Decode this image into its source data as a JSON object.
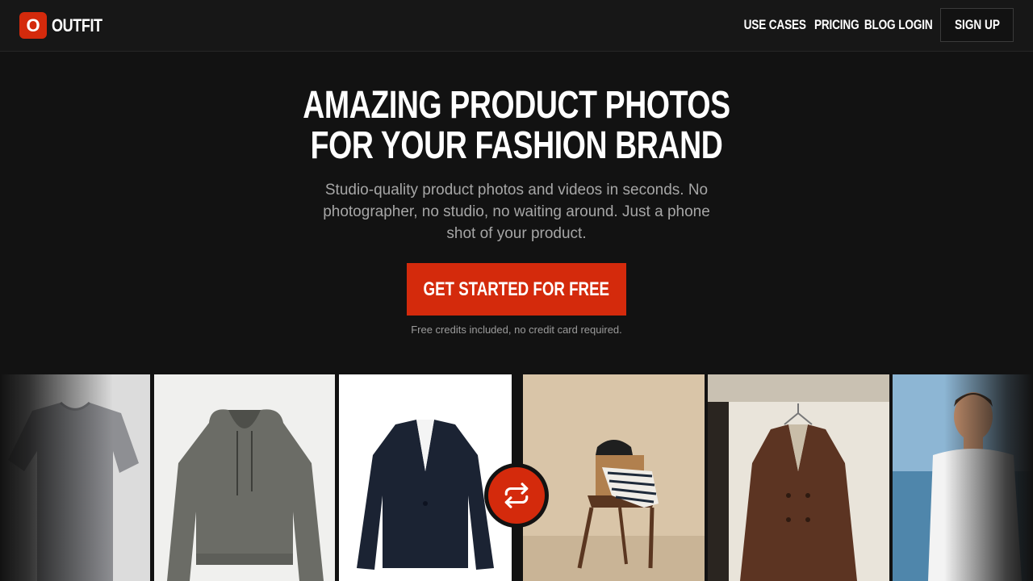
{
  "brand": {
    "logo_letter": "O",
    "name": "OUTFIT",
    "accent": "#d42a0c"
  },
  "nav": {
    "links": [
      "USE CASES",
      "PRICING",
      "BLOG",
      "LOGIN"
    ],
    "signup": "SIGN UP"
  },
  "hero": {
    "title_line1": "AMAZING PRODUCT PHOTOS",
    "title_line2": "FOR YOUR FASHION BRAND",
    "subtitle": "Studio-quality product photos and videos in seconds. No photographer, no studio, no waiting around. Just a phone shot of your product.",
    "cta": "GET STARTED FOR FREE",
    "cta_note": "Free credits included, no credit card required."
  },
  "gallery": {
    "items": [
      "gray-tshirt",
      "gray-hoodie",
      "navy-pinstripe-blazer",
      "chair-with-striped-shirt",
      "brown-coat-on-hanger",
      "model-white-tee-beach"
    ],
    "swap_icon": "repeat-icon"
  }
}
